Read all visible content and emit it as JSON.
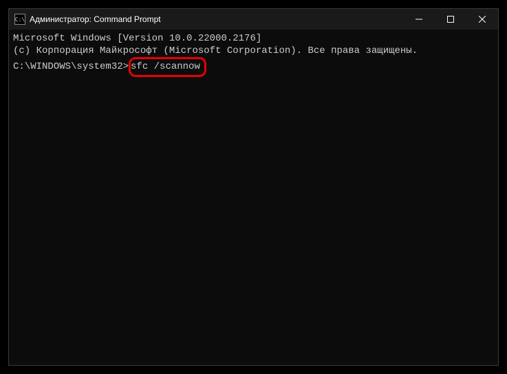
{
  "titlebar": {
    "icon_label": "C:\\",
    "title": "Администратор: Command Prompt"
  },
  "terminal": {
    "line1": "Microsoft Windows [Version 10.0.22000.2176]",
    "line2": "(c) Корпорация Майкрософт (Microsoft Corporation). Все права защищены.",
    "blank": "",
    "prompt": "C:\\WINDOWS\\system32>",
    "command": "sfc /scannow"
  }
}
